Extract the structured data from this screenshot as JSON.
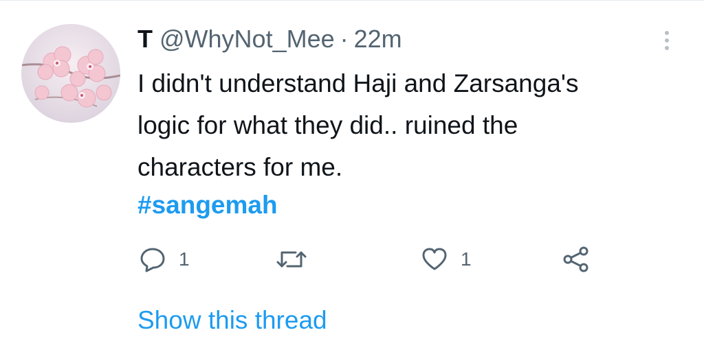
{
  "author": {
    "display_name": "T",
    "handle": "@WhyNot_Mee",
    "separator": "·",
    "time": "22m"
  },
  "tweet": {
    "lines": [
      "I didn't understand Haji and Zarsanga's",
      "logic for what they did.. ruined the",
      "characters for me."
    ],
    "hashtag": "#sangemah"
  },
  "actions": {
    "reply_count": "1",
    "like_count": "1"
  },
  "show_thread_label": "Show this thread",
  "colors": {
    "link": "#1d9bf0",
    "text": "#0f1419",
    "secondary": "#536471"
  }
}
